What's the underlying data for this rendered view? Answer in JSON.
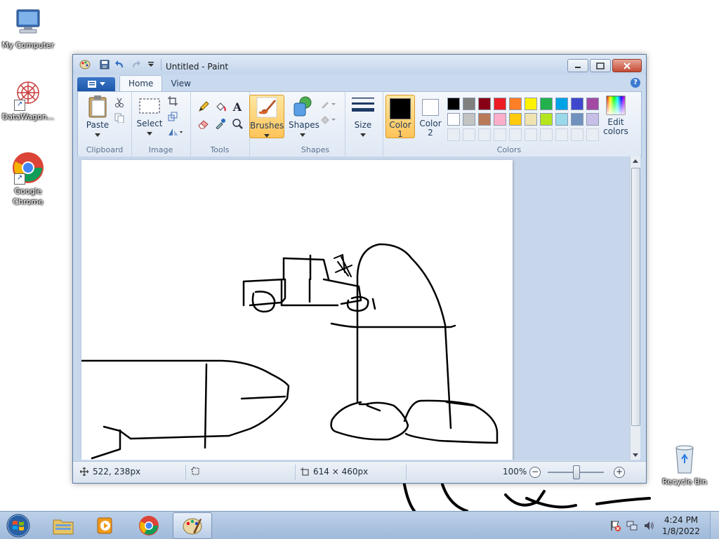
{
  "desktop": {
    "icons": [
      {
        "label": "My Computer"
      },
      {
        "label": "DataWagon..."
      },
      {
        "label": "Google Chrome"
      },
      {
        "label": "Recycle Bin"
      }
    ]
  },
  "window": {
    "title": "Untitled - Paint",
    "tabs": [
      {
        "label": "Home",
        "active": true
      },
      {
        "label": "View",
        "active": false
      }
    ]
  },
  "ribbon": {
    "clipboard": {
      "paste_label": "Paste",
      "group_label": "Clipboard"
    },
    "image": {
      "select_label": "Select",
      "group_label": "Image"
    },
    "tools": {
      "group_label": "Tools",
      "text_tool": "A"
    },
    "brushes": {
      "label": "Brushes"
    },
    "shapes": {
      "shapes_label": "Shapes",
      "group_label": "Shapes"
    },
    "size": {
      "label": "Size"
    },
    "colors": {
      "color1_label": "Color",
      "color1_num": "1",
      "color2_label": "Color",
      "color2_num": "2",
      "edit_label": "Edit",
      "edit_label2": "colors",
      "group_label": "Colors",
      "color1_value": "#000000",
      "color2_value": "#ffffff",
      "palette_row1": [
        "#000000",
        "#7f7f7f",
        "#880015",
        "#ed1c24",
        "#ff7f27",
        "#fff200",
        "#22b14c",
        "#00a2e8",
        "#3f48cc",
        "#a349a4"
      ],
      "palette_row2": [
        "#ffffff",
        "#c3c3c3",
        "#b97a57",
        "#ffaec9",
        "#ffc90e",
        "#efe4b0",
        "#b5e61d",
        "#99d9ea",
        "#7092be",
        "#c8bfe7"
      ]
    }
  },
  "status": {
    "cursor_pos": "522, 238px",
    "canvas_size": "614 × 460px",
    "zoom": "100%",
    "zoom_minus": "−",
    "zoom_plus": "+"
  },
  "taskbar": {
    "time": "4:24 PM",
    "date": "1/8/2022"
  },
  "colors": {
    "accent_orange": "#ffc45a",
    "ribbon_blue": "#1f57a8"
  }
}
